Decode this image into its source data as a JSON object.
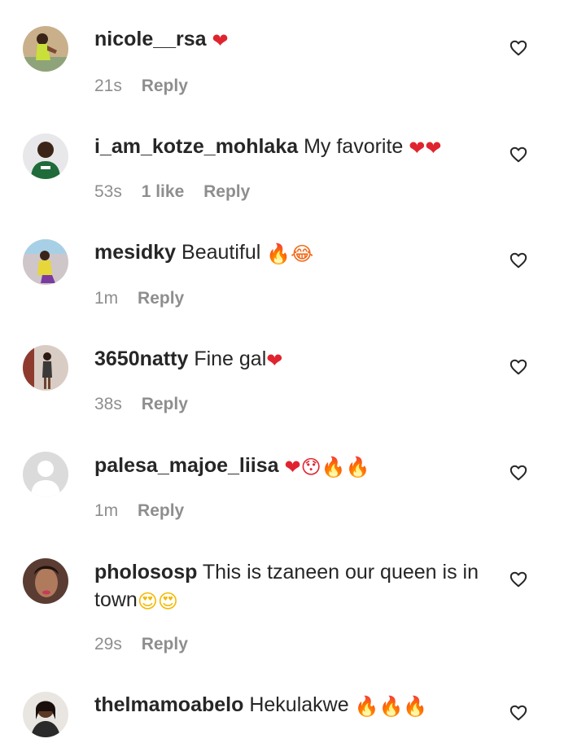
{
  "reply_label": "Reply",
  "icons": {
    "like": "heart-outline-icon",
    "heart": "red-heart-emoji",
    "fire": "fire-emoji",
    "face_laugh": "grinning-sweat-emoji",
    "face_surprised": "hushed-face-emoji",
    "face_hearts": "heart-eyes-emoji"
  },
  "colors": {
    "username": "#262626",
    "meta": "#8e8e8e",
    "heart": "#e0242f",
    "fire": "#f26a1b"
  },
  "comments": [
    {
      "username": "nicole__rsa",
      "text": "",
      "emoji": "❤",
      "time": "21s",
      "likes": ""
    },
    {
      "username": "i_am_kotze_mohlaka",
      "text": "My favorite",
      "emoji": "❤❤",
      "time": "53s",
      "likes": "1 like"
    },
    {
      "username": "mesidky",
      "text": "Beautiful",
      "emoji": "🔥😂",
      "time": "1m",
      "likes": ""
    },
    {
      "username": "3650natty",
      "text": "Fine gal",
      "emoji": "❤",
      "time": "38s",
      "likes": ""
    },
    {
      "username": "palesa_majoe_liisa",
      "text": "",
      "emoji": "❤😯🔥🔥",
      "time": "1m",
      "likes": ""
    },
    {
      "username": "pholososp",
      "text": "This is tzaneen our queen is in town",
      "emoji": "😍😍",
      "time": "29s",
      "likes": ""
    },
    {
      "username": "thelmamoabelo",
      "text": "Hekulakwe",
      "emoji": "🔥🔥🔥",
      "time": "",
      "likes": ""
    }
  ]
}
